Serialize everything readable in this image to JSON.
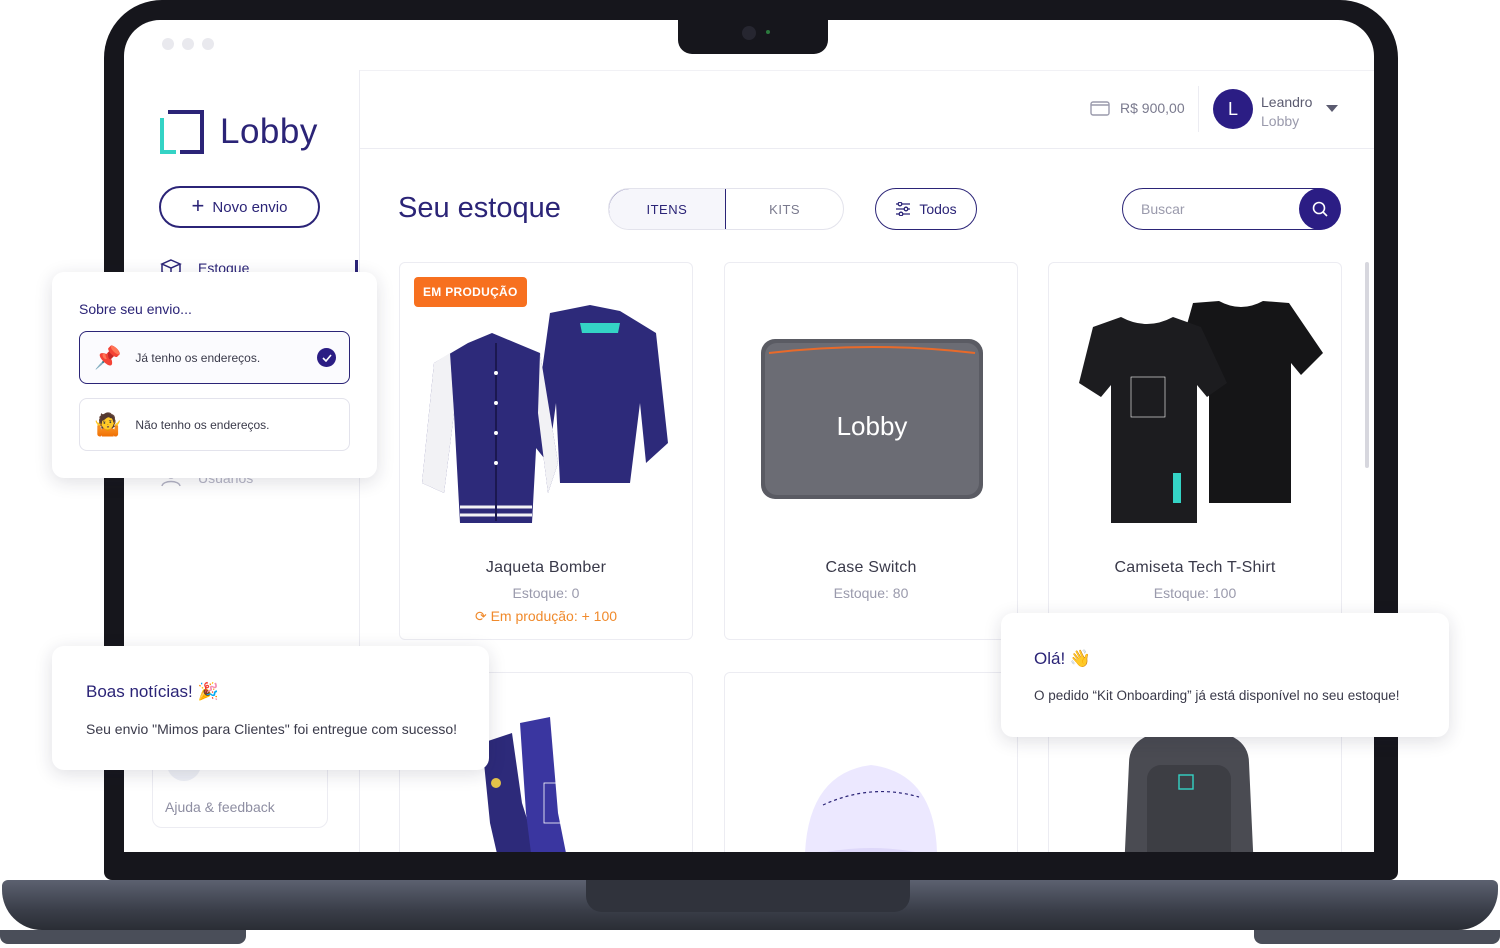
{
  "app": {
    "logo_text": "Lobby",
    "brand_color": "#2b2477",
    "accent_color": "#34d3c5",
    "warning_color": "#f7701f"
  },
  "sidebar": {
    "new_button_label": "Novo envio",
    "items": [
      {
        "label": "Estoque",
        "icon": "box-icon",
        "active": true
      },
      {
        "label": "Usuários",
        "icon": "users-icon",
        "active": false
      }
    ],
    "help_label": "Ajuda & feedback"
  },
  "header": {
    "balance": "R$ 900,00",
    "user_initial": "L",
    "user_name": "Leandro",
    "user_company": "Lobby"
  },
  "main": {
    "title": "Seu estoque",
    "tabs": [
      {
        "label": "ITENS",
        "active": true
      },
      {
        "label": "KITS",
        "active": false
      }
    ],
    "filter_label": "Todos",
    "search_placeholder": "Buscar",
    "products": [
      {
        "name": "Jaqueta Bomber",
        "stock": "Estoque: 0",
        "badge": "EM PRODUÇÃO",
        "production": "Em produção: + 100"
      },
      {
        "name": "Case Switch",
        "stock": "Estoque: 80",
        "case_brand": "Lobby"
      },
      {
        "name": "Camiseta Tech T-Shirt",
        "stock": "Estoque: 100"
      }
    ]
  },
  "popups": {
    "envio": {
      "title": "Sobre seu envio...",
      "options": [
        {
          "label": "Já tenho os endereços.",
          "selected": true,
          "icon": "pushpin-icon"
        },
        {
          "label": "Não tenho os endereços.",
          "selected": false,
          "icon": "shrug-icon"
        }
      ]
    },
    "boas": {
      "title": "Boas notícias!",
      "emoji": "🎉",
      "message": "Seu envio \"Mimos para Clientes\" foi entregue com sucesso!"
    },
    "ola": {
      "title": "Olá!",
      "emoji": "👋",
      "message": "O pedido “Kit Onboarding” já está disponível no seu estoque!"
    }
  }
}
